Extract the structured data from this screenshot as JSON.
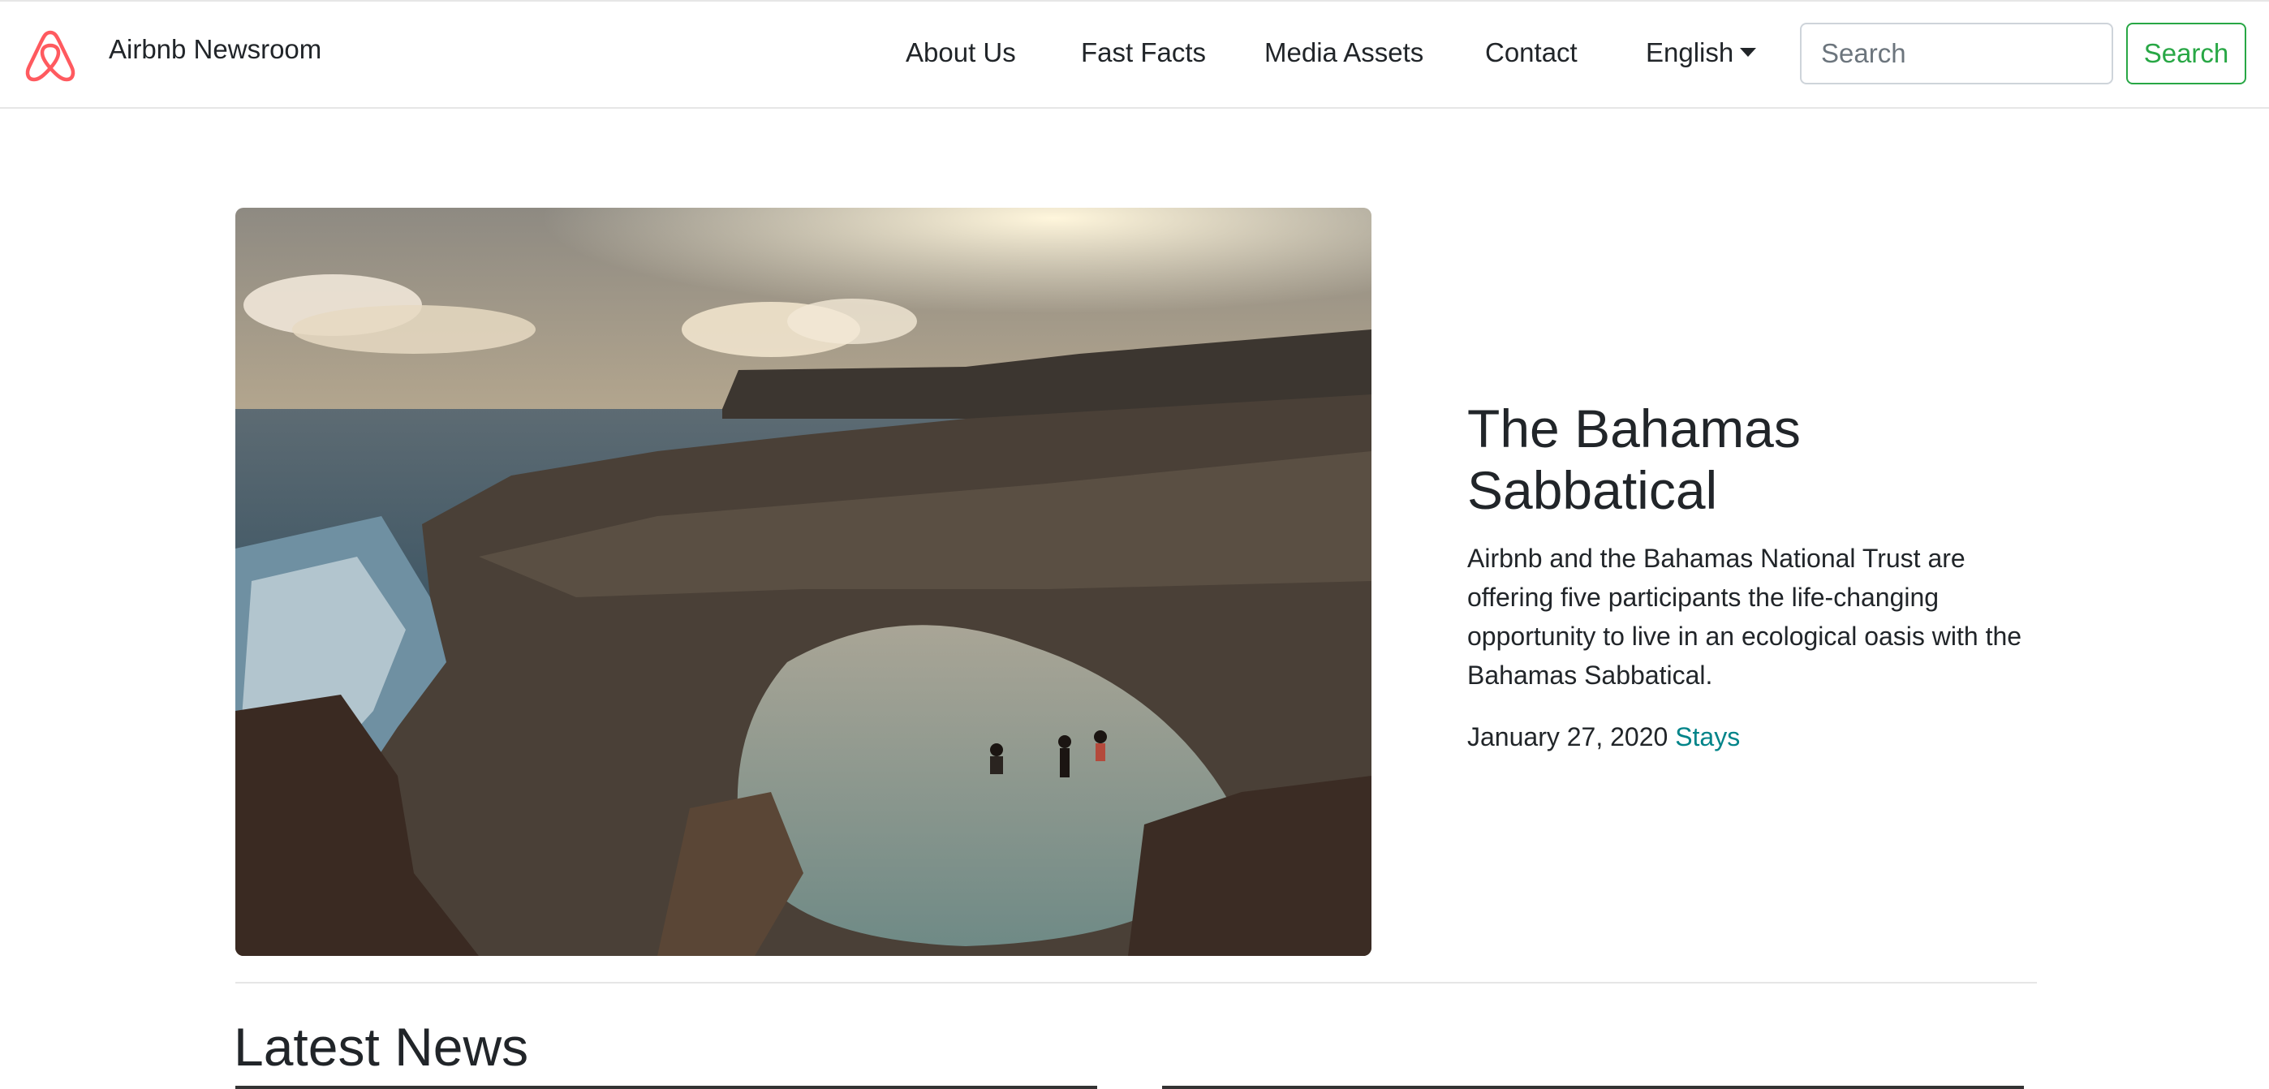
{
  "brand": {
    "name": "Airbnb Newsroom",
    "logo_icon": "airbnb-belo-icon",
    "logo_color": "#ff5a5f"
  },
  "nav": {
    "items": [
      {
        "label": "About Us"
      },
      {
        "label": "Fast Facts"
      },
      {
        "label": "Media Assets"
      },
      {
        "label": "Contact"
      }
    ],
    "language": {
      "label": "English",
      "icon": "caret-down-icon"
    }
  },
  "search": {
    "placeholder": "Search",
    "button_label": "Search",
    "accent_color": "#28a745"
  },
  "featured": {
    "title": "The Bahamas Sabbatical",
    "description": "Airbnb and the Bahamas National Trust are offering five participants the life-changing opportunity to live in an ecological oasis with the Bahamas Sabbatical.",
    "date": "January 27, 2020",
    "tag": "Stays",
    "tag_color": "#008489",
    "image_subject": "coastal-rock-pool-photo"
  },
  "latest": {
    "heading": "Latest News"
  }
}
